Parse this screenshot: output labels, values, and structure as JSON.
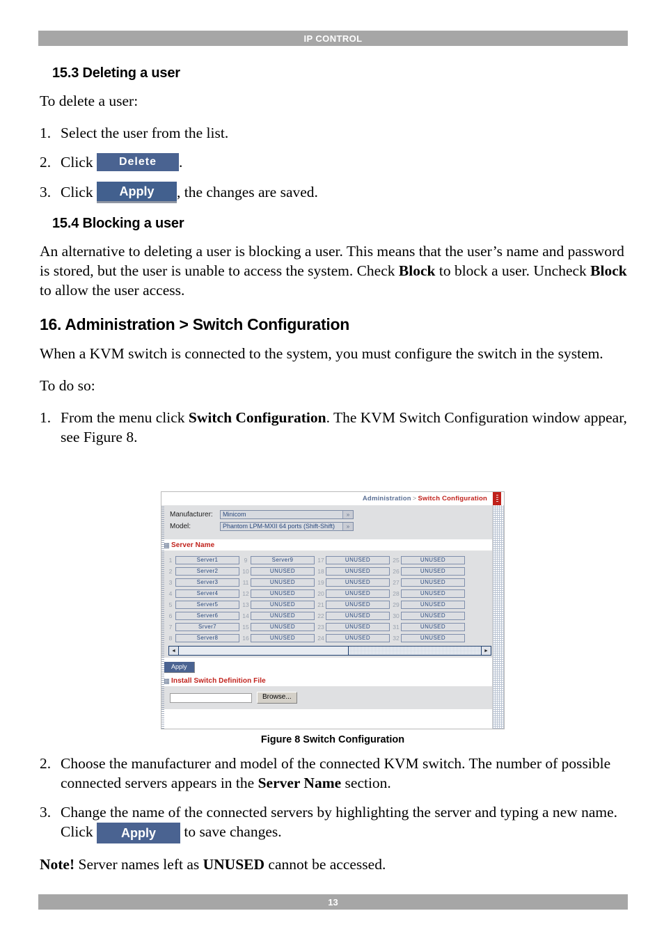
{
  "header": {
    "running_title": "IP CONTROL"
  },
  "footer": {
    "page_number": "13"
  },
  "sections": {
    "s15_3": {
      "heading": "15.3 Deleting a user",
      "intro": "To delete a user:",
      "steps": [
        {
          "num": "1.",
          "text": "Select the user from the list."
        },
        {
          "num": "2.",
          "pre": "Click ",
          "button": "Delete",
          "post": "."
        },
        {
          "num": "3.",
          "pre": "Click ",
          "button": "Apply",
          "post": ", the changes are saved."
        }
      ]
    },
    "s15_4": {
      "heading": "15.4 Blocking a user",
      "body_1": "An alternative to deleting a user is blocking a user. This means that the user’s name and password is stored, but the user is unable to access the system. Check ",
      "bold_1": "Block",
      "body_2": " to block a user. Uncheck ",
      "bold_2": "Block",
      "body_3": " to allow the user access."
    },
    "s16": {
      "heading": "16. Administration > Switch Configuration",
      "body": "When a KVM switch is connected to the system, you must configure the switch in the system.",
      "to_do_so": "To do so:",
      "step_1": {
        "num": "1.",
        "pre": "From the menu click ",
        "bold": "Switch Configuration",
        "post": ". The KVM Switch Configuration window appear, see Figure 8."
      },
      "step_2": {
        "num": "2.",
        "pre": "Choose the manufacturer and model of the connected KVM switch. The number of possible connected servers appears in the ",
        "bold": "Server Name",
        "post": " section."
      },
      "step_3": {
        "num": "3.",
        "pre": "Change the name of the connected servers by highlighting the server and typing a new name. Click ",
        "button": "Apply",
        "post": " to save changes."
      },
      "note": {
        "label": "Note!",
        "pre": " Server names left as ",
        "bold": "UNUSED",
        "post": " cannot be accessed."
      }
    }
  },
  "figure": {
    "caption": "Figure 8 Switch Configuration",
    "breadcrumb": {
      "parent": "Administration",
      "separator": ">",
      "current": "Switch Configuration"
    },
    "fields": {
      "manufacturer_label": "Manufacturer:",
      "manufacturer_value": "Minicom",
      "model_label": "Model:",
      "model_value": "Phantom LPM-MXII 64 ports (Shift-Shift)",
      "dropdown_arrow": "»"
    },
    "server_name_section": {
      "title": "Server Name",
      "columns": [
        {
          "indices": [
            "1",
            "2",
            "3",
            "4",
            "5",
            "6",
            "7",
            "8"
          ],
          "values": [
            "Server1",
            "Server2",
            "Server3",
            "Server4",
            "Server5",
            "Server6",
            "Srver7",
            "Server8"
          ]
        },
        {
          "indices": [
            "9",
            "10",
            "11",
            "12",
            "13",
            "14",
            "15",
            "16"
          ],
          "values": [
            "Server9",
            "UNUSED",
            "UNUSED",
            "UNUSED",
            "UNUSED",
            "UNUSED",
            "UNUSED",
            "UNUSED"
          ]
        },
        {
          "indices": [
            "17",
            "18",
            "19",
            "20",
            "21",
            "22",
            "23",
            "24"
          ],
          "values": [
            "UNUSED",
            "UNUSED",
            "UNUSED",
            "UNUSED",
            "UNUSED",
            "UNUSED",
            "UNUSED",
            "UNUSED"
          ]
        },
        {
          "indices": [
            "25",
            "26",
            "27",
            "28",
            "29",
            "30",
            "31",
            "32"
          ],
          "values": [
            "UNUSED",
            "UNUSED",
            "UNUSED",
            "UNUSED",
            "UNUSED",
            "UNUSED",
            "UNUSED",
            "UNUSED"
          ]
        }
      ]
    },
    "scrollbar": {
      "left_arrow": "◄",
      "right_arrow": "►"
    },
    "apply_button": "Apply",
    "install_section": {
      "title": "Install Switch Definition File",
      "file_value": "",
      "browse_label": "Browse..."
    }
  },
  "colors": {
    "header_gray": "#a6a6a6",
    "button_blue": "#4a6391",
    "accent_red": "#c0211b",
    "crumb_blue": "#5a6f94",
    "field_text_blue": "#2b4a7e"
  }
}
